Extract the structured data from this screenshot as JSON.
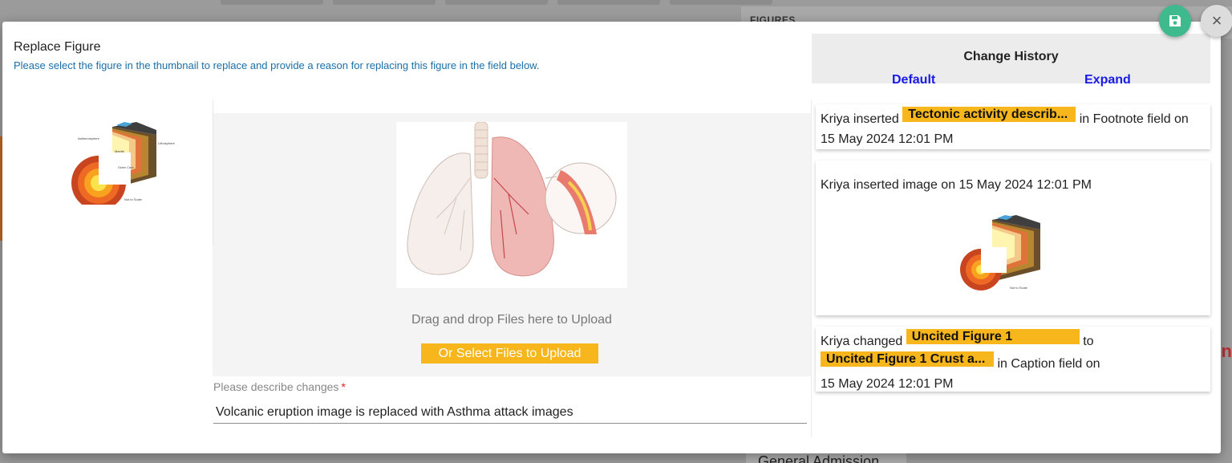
{
  "background": {
    "figures_label": "FIGURES",
    "bottom_text": "General Admission",
    "right_glyph": "n"
  },
  "modal": {
    "title": "Replace Figure",
    "instructions": "Please select the figure in the thumbnail to replace and provide a reason for replacing this figure in the field below.",
    "thumbnail_icon": "earth-layers-diagram",
    "preview_icon": "lungs-asthma-illustration",
    "drag_text": "Drag and drop Files here to Upload",
    "select_button": "Or Select Files to Upload",
    "describe_label": "Please describe changes",
    "required_mark": "*",
    "describe_value": "Volcanic eruption image is replaced with Asthma attack images"
  },
  "history": {
    "title": "Change History",
    "default_link": "Default",
    "expand_link": "Expand",
    "entry1": {
      "prefix": "Kriya inserted",
      "tag": "Tectonic activity describ...",
      "suffix": "in Footnote field on",
      "date": "15 May 2024 12:01 PM"
    },
    "entry2": {
      "text": "Kriya inserted image on 15 May 2024 12:01 PM",
      "image_icon": "earth-layers-diagram"
    },
    "entry3": {
      "prefix": "Kriya changed",
      "tag1": "Uncited Figure 1",
      "to": "to",
      "tag2": "Uncited Figure 1 Crust a...",
      "suffix": "in Caption field on",
      "date": "15 May 2024 12:01 PM"
    }
  },
  "actions": {
    "save_icon": "save-icon",
    "close_symbol": "×"
  },
  "colors": {
    "accent_yellow": "#f6b61c",
    "link_blue": "#1a1ae8",
    "instruction_blue": "#1a6fa8",
    "save_green": "#3eba8e"
  }
}
